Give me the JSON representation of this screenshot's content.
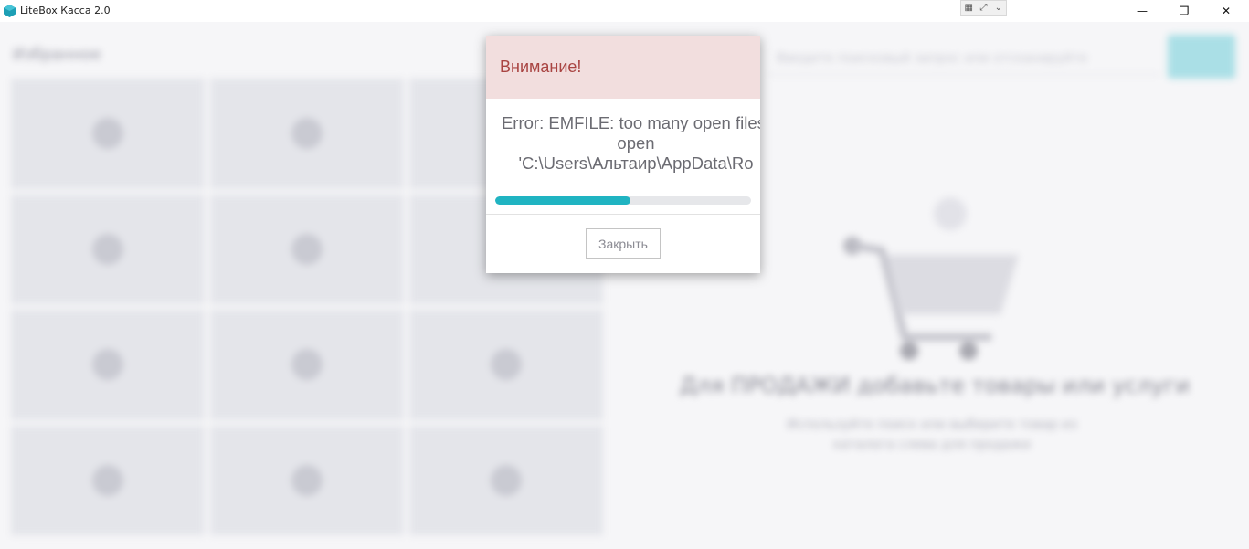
{
  "window": {
    "title": "LiteBox Касса 2.0",
    "logo_icon": "litebox-logo-icon",
    "controls": {
      "minimize": "—",
      "maximize": "❐",
      "close": "✕"
    },
    "extra_controls": [
      "grid-icon",
      "fullscreen-icon",
      "chevron-down-icon"
    ]
  },
  "background": {
    "heading": "Избранное",
    "search_placeholder": "Введите поисковый запрос или отсканируйте",
    "empty_title": "Для ПРОДАЖИ добавьте товары или услуги",
    "empty_description": "Используйте поиск или выберите товар из каталога слева для продажи"
  },
  "dialog": {
    "title": "Внимание!",
    "message": "Error: EMFILE: too many open files, open 'C:\\Users\\Альтаир\\AppData\\Ro",
    "progress": 0.53,
    "close_label": "Закрыть",
    "colors": {
      "header_bg": "#f2dede",
      "title": "#a94442",
      "progress": "#20b4c2"
    }
  }
}
